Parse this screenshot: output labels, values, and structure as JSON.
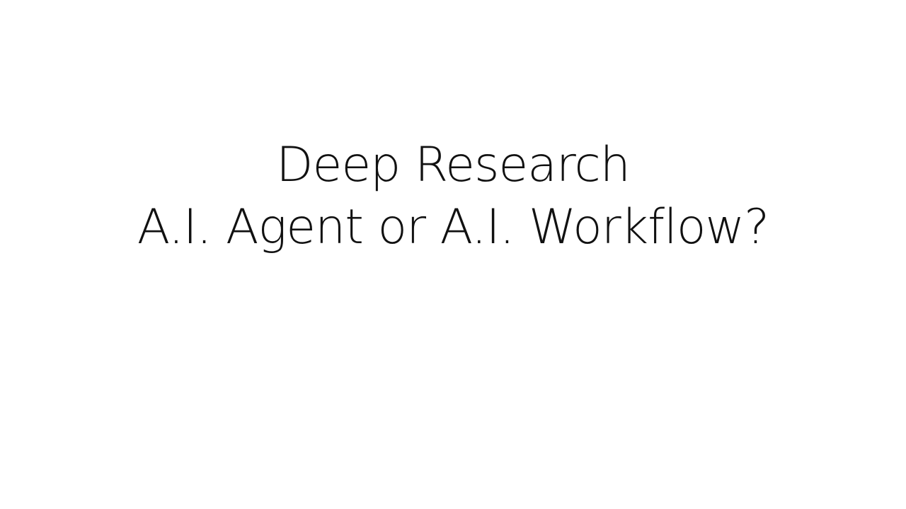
{
  "slide": {
    "title_line_1": "Deep Research",
    "title_line_2": "A.I. Agent or A.I. Workflow?"
  },
  "colors": {
    "background": "#ffffff",
    "text": "#111111"
  }
}
